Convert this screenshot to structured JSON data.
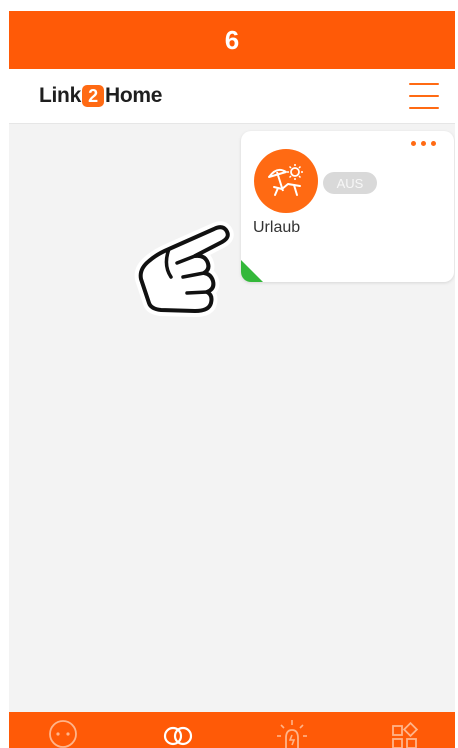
{
  "step_number": "6",
  "brand": {
    "part1": "Link",
    "badge": "2",
    "part2": "Home"
  },
  "icons": {
    "menu": "hamburger-menu-icon",
    "more": "more-dots-icon",
    "scene": "beach-umbrella-lounger-icon",
    "pointer": "pointing-hand-icon",
    "nav": [
      "socket-icon",
      "scenes-link-icon",
      "light-bulb-icon",
      "apps-grid-icon"
    ]
  },
  "scene_card": {
    "name": "Urlaub",
    "status": "AUS"
  },
  "colors": {
    "accent": "#ff6a13",
    "banner": "#ff5a07",
    "status_pill": "#d9d9d9",
    "corner_flag": "#34b83a"
  }
}
